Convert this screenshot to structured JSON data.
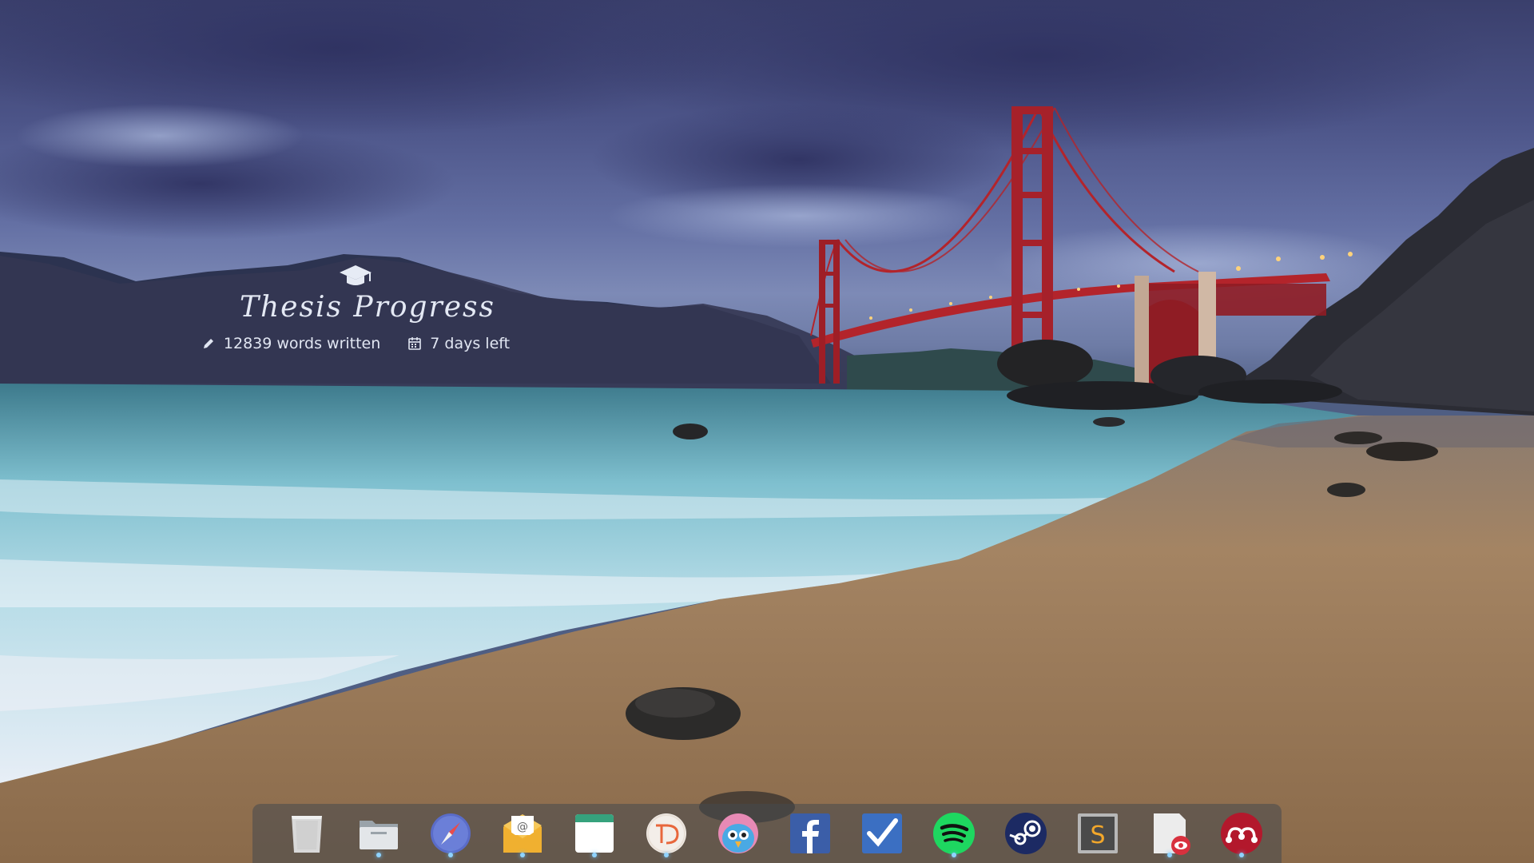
{
  "widget": {
    "icon": "graduation-cap-icon",
    "title": "Thesis  Progress",
    "words_written": "12839 words written",
    "days_left": "7 days left",
    "words_icon": "pencil-icon",
    "days_icon": "calendar-icon"
  },
  "dock": {
    "items": [
      {
        "name": "trash",
        "icon": "trash-icon",
        "running": false
      },
      {
        "name": "files",
        "icon": "folder-icon",
        "running": true
      },
      {
        "name": "web-browser",
        "icon": "compass-icon",
        "running": true
      },
      {
        "name": "mail",
        "icon": "mail-icon",
        "running": true
      },
      {
        "name": "calendar",
        "icon": "calendar-app-icon",
        "running": true
      },
      {
        "name": "todoist",
        "icon": "todoist-icon",
        "running": true
      },
      {
        "name": "twitter-client",
        "icon": "bird-icon",
        "running": false
      },
      {
        "name": "facebook",
        "icon": "facebook-icon",
        "running": false
      },
      {
        "name": "tasks",
        "icon": "checkmark-icon",
        "running": false
      },
      {
        "name": "spotify",
        "icon": "spotify-icon",
        "running": true
      },
      {
        "name": "steam",
        "icon": "steam-icon",
        "running": false
      },
      {
        "name": "sublime-text",
        "icon": "sublime-icon",
        "running": false
      },
      {
        "name": "document-viewer",
        "icon": "document-viewer-icon",
        "running": true
      },
      {
        "name": "mendeley",
        "icon": "mendeley-icon",
        "running": true
      }
    ]
  },
  "colors": {
    "bridge": "#b3242b",
    "dock_bg": "#46484e",
    "indicator": "#8fd3ff"
  }
}
